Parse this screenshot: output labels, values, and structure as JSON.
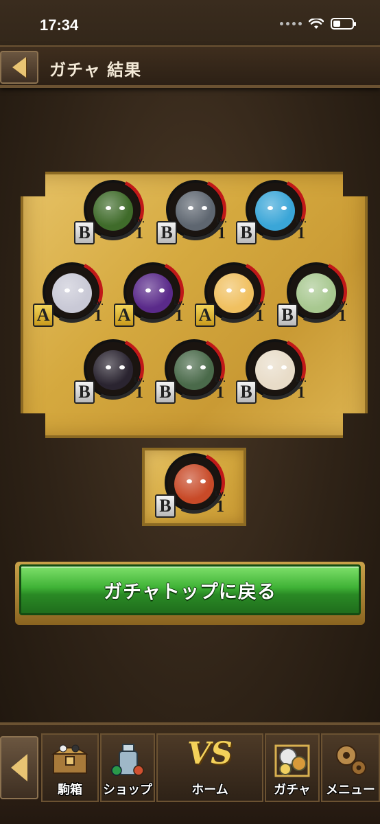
{
  "status": {
    "time": "17:34"
  },
  "header": {
    "title": "ガチャ 結果"
  },
  "results": [
    {
      "rank": "B",
      "lv_label": "Lv.",
      "level": "1",
      "color": "#3f6b2a"
    },
    {
      "rank": "B",
      "lv_label": "Lv.",
      "level": "1",
      "color": "#5e6670"
    },
    {
      "rank": "B",
      "lv_label": "Lv.",
      "level": "1",
      "color": "#3aa6d8"
    },
    {
      "rank": "A",
      "lv_label": "Lv.",
      "level": "1",
      "color": "#c9c9d6"
    },
    {
      "rank": "A",
      "lv_label": "Lv.",
      "level": "1",
      "color": "#5a2a8a"
    },
    {
      "rank": "A",
      "lv_label": "Lv.",
      "level": "1",
      "color": "#f0c060"
    },
    {
      "rank": "B",
      "lv_label": "Lv.",
      "level": "1",
      "color": "#a8c890"
    },
    {
      "rank": "B",
      "lv_label": "Lv.",
      "level": "1",
      "color": "#2a2430"
    },
    {
      "rank": "B",
      "lv_label": "Lv.",
      "level": "1",
      "color": "#4a6a4a"
    },
    {
      "rank": "B",
      "lv_label": "Lv.",
      "level": "1",
      "color": "#e8dcc8"
    },
    {
      "rank": "B",
      "lv_label": "Lv.",
      "level": "1",
      "color": "#c84a28"
    }
  ],
  "return_button": {
    "label": "ガチャトップに戻る"
  },
  "nav": {
    "items": [
      {
        "label": "駒箱",
        "icon": "treasure-chest-icon"
      },
      {
        "label": "ショップ",
        "icon": "shop-bottle-icon"
      },
      {
        "label": "ホーム",
        "icon": "vs-home-icon",
        "emblem": "VS"
      },
      {
        "label": "ガチャ",
        "icon": "gacha-coins-icon"
      },
      {
        "label": "メニュー",
        "icon": "gear-icon"
      }
    ]
  },
  "colors": {
    "gold": "#d5a93f",
    "green": "#3fb236",
    "rank_a": "#f3d55a",
    "rank_b": "#d8d8d8",
    "level_arc": "#c01818"
  }
}
